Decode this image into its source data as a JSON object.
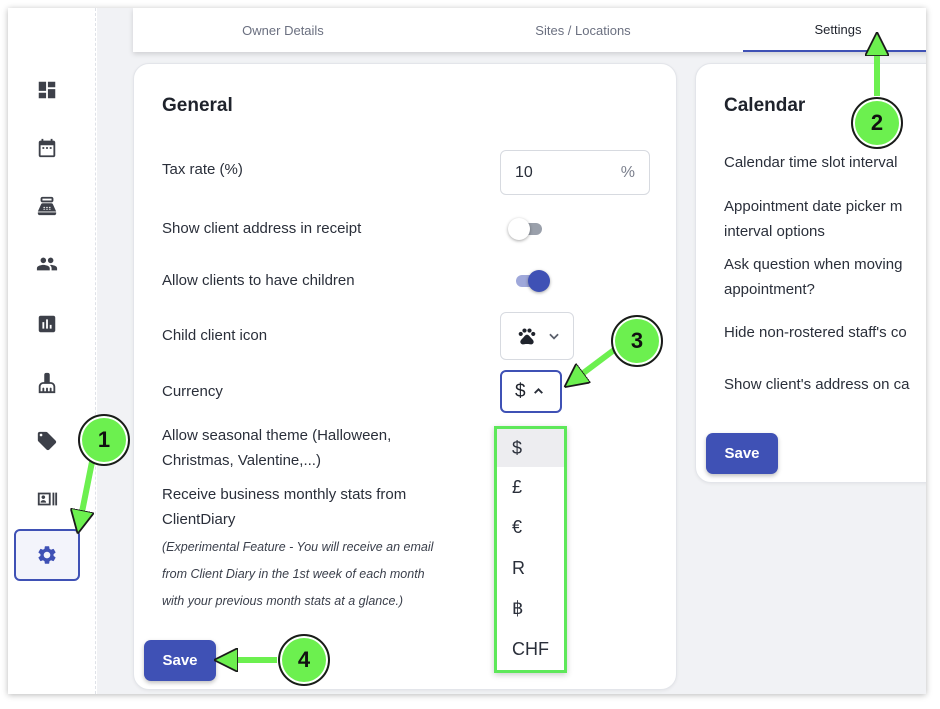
{
  "sidebar": {
    "items": [
      {
        "name": "dashboard-icon"
      },
      {
        "name": "calendar-icon"
      },
      {
        "name": "point-of-sale-icon"
      },
      {
        "name": "clients-icon"
      },
      {
        "name": "reports-icon"
      },
      {
        "name": "cleaning-icon"
      },
      {
        "name": "tag-icon"
      },
      {
        "name": "staff-card-icon"
      },
      {
        "name": "gear-icon"
      }
    ]
  },
  "tabs": [
    {
      "label": "Owner Details"
    },
    {
      "label": "Sites / Locations"
    },
    {
      "label": "Settings",
      "active": true
    }
  ],
  "general": {
    "title": "General",
    "tax_rate_label": "Tax rate (%)",
    "tax_rate_value": "10",
    "tax_rate_unit": "%",
    "show_address_label": "Show client address in receipt",
    "show_address_on": false,
    "allow_children_label": "Allow clients to have children",
    "allow_children_on": true,
    "child_icon_label": "Child client icon",
    "child_icon_value": "paw-icon",
    "currency_label": "Currency",
    "currency_value": "$",
    "seasonal_label_1": "Allow seasonal theme (Halloween,",
    "seasonal_label_2": "Christmas, Valentine,...)",
    "stats_label_1": "Receive business monthly stats from",
    "stats_label_2": "ClientDiary",
    "note_1": "(Experimental Feature - You will receive an email",
    "note_2": "from Client Diary in the 1st week of each month",
    "note_3": "with your previous month stats at a glance.)",
    "save_label": "Save"
  },
  "currency_options": [
    "$",
    "£",
    "€",
    "R",
    "฿",
    "CHF"
  ],
  "calendar": {
    "title": "Calendar",
    "time_slot_label": "Calendar time slot interval",
    "date_picker_label_1": "Appointment date picker m",
    "date_picker_label_2": "interval options",
    "ask_question_label_1": "Ask question when moving",
    "ask_question_label_2": "appointment?",
    "hide_staff_label": "Hide non-rostered staff's co",
    "show_address_label": "Show client's address on ca",
    "save_label": "Save"
  },
  "callouts": [
    "1",
    "2",
    "3",
    "4"
  ],
  "colors": {
    "accent": "#3f51b5",
    "highlight": "#6cf04f"
  }
}
